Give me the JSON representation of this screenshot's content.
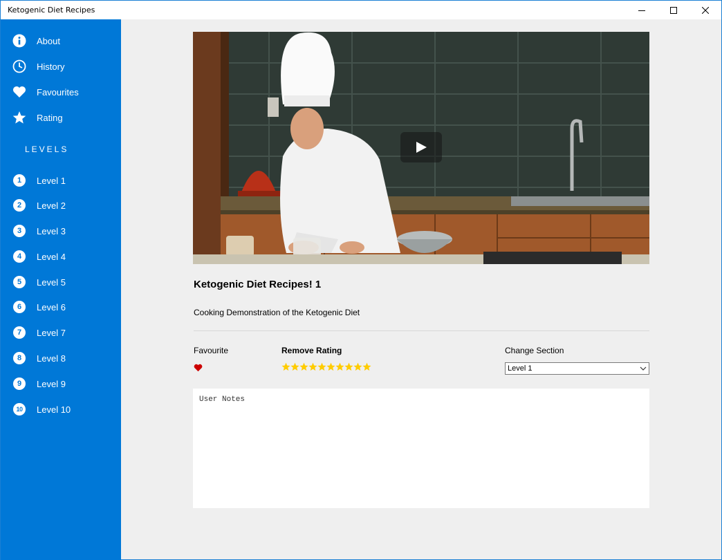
{
  "window": {
    "title": "Ketogenic Diet Recipes"
  },
  "sidebar": {
    "items": [
      {
        "label": "About",
        "icon": "info-icon"
      },
      {
        "label": "History",
        "icon": "clock-icon"
      },
      {
        "label": "Favourites",
        "icon": "heart-icon"
      },
      {
        "label": "Rating",
        "icon": "star-icon"
      }
    ],
    "levels_header": "LEVELS",
    "levels": [
      {
        "num": "1",
        "label": "Level 1"
      },
      {
        "num": "2",
        "label": "Level 2"
      },
      {
        "num": "3",
        "label": "Level 3"
      },
      {
        "num": "4",
        "label": "Level 4"
      },
      {
        "num": "5",
        "label": "Level 5"
      },
      {
        "num": "6",
        "label": "Level 6"
      },
      {
        "num": "7",
        "label": "Level 7"
      },
      {
        "num": "8",
        "label": "Level 8"
      },
      {
        "num": "9",
        "label": "Level 9"
      },
      {
        "num": "10",
        "label": "Level 10"
      }
    ]
  },
  "main": {
    "title": "Ketogenic Diet Recipes! 1",
    "description": "Cooking Demonstration of the Ketogenic Diet",
    "favourite_label": "Favourite",
    "rating_label": "Remove Rating",
    "rating_value": 10,
    "rating_max": 10,
    "section_label": "Change Section",
    "section_selected": "Level 1",
    "notes_placeholder": "User Notes"
  },
  "colors": {
    "sidebar_bg": "#0078d7",
    "heart": "#cc0000",
    "star": "#ffcc00"
  }
}
